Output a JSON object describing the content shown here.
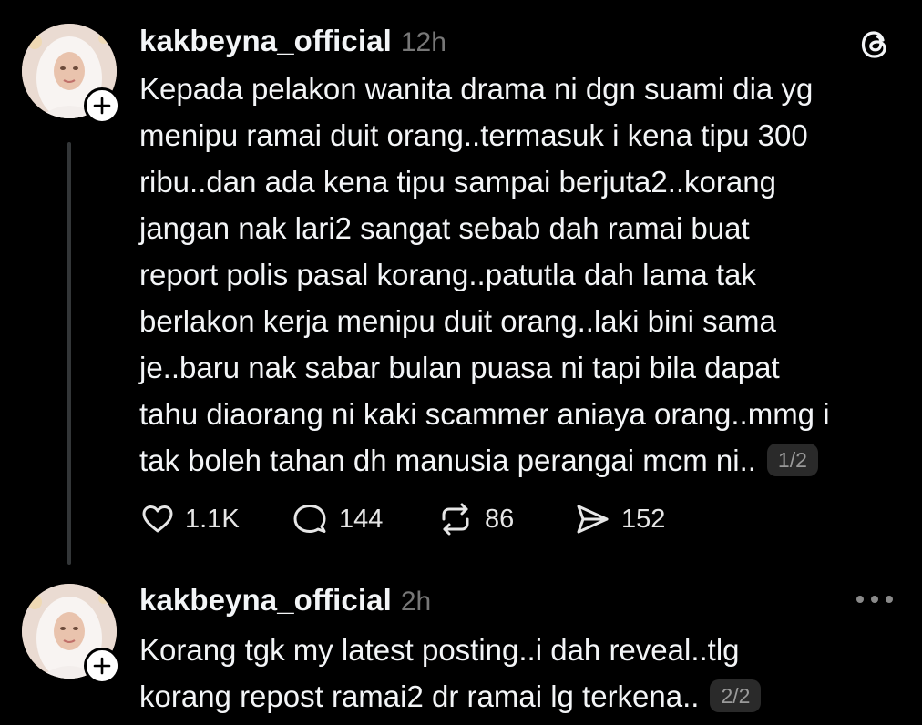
{
  "posts": [
    {
      "username": "kakbeyna_official",
      "time": "12h",
      "text": "Kepada pelakon wanita drama ni dgn suami dia yg\nmenipu ramai duit orang..termasuk i kena tipu 300\nribu..dan ada kena tipu sampai berjuta2..korang\njangan nak lari2 sangat sebab dah ramai buat\nreport polis pasal korang..patutla dah lama tak\nberlakon kerja menipu duit orang..laki bini sama\nje..baru nak sabar bulan puasa ni tapi bila dapat\ntahu diaorang ni kaki scammer aniaya orang..mmg i\ntak boleh tahan dh manusia perangai mcm ni..",
      "page_indicator": "1/2",
      "likes": "1.1K",
      "replies": "144",
      "reposts": "86",
      "shares": "152"
    },
    {
      "username": "kakbeyna_official",
      "time": "2h",
      "text": "Korang tgk my latest posting..i dah reveal..tlg\nkorang repost ramai2 dr ramai lg terkena..",
      "page_indicator": "2/2"
    }
  ],
  "icons": {
    "brand": "threads-logo-icon",
    "more": "more-options-icon",
    "follow": "plus-icon",
    "like": "heart-icon",
    "reply": "comment-bubble-icon",
    "repost": "repost-arrows-icon",
    "share": "send-icon"
  },
  "colors": {
    "background": "#000000",
    "primary_text": "#f3f5f7",
    "secondary_text": "#777777",
    "thread_line": "#333638",
    "pill_background": "#2a2a2a"
  }
}
